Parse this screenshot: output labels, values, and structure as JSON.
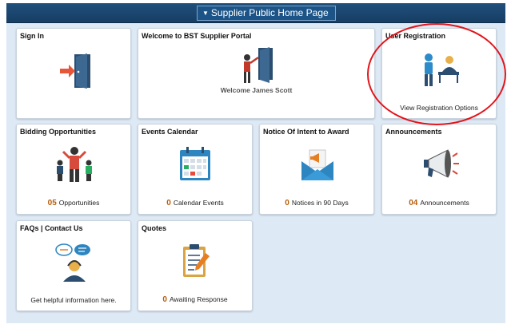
{
  "header": {
    "home_label": "Supplier Public Home Page"
  },
  "tiles": {
    "sign_in": {
      "title": "Sign In"
    },
    "welcome": {
      "title": "Welcome to BST Supplier Portal",
      "name": "Welcome James Scott"
    },
    "registration": {
      "title": "User Registration",
      "footer": "View Registration Options"
    },
    "bidding": {
      "title": "Bidding Opportunities",
      "count": "05",
      "footer": "Opportunities"
    },
    "events": {
      "title": "Events Calendar",
      "count": "0",
      "footer": "Calendar Events"
    },
    "notice": {
      "title": "Notice Of Intent to Award",
      "count": "0",
      "footer": "Notices in 90 Days"
    },
    "announcements": {
      "title": "Announcements",
      "count": "04",
      "footer": "Announcements"
    },
    "faqs": {
      "title": "FAQs | Contact Us",
      "footer": "Get helpful information here."
    },
    "quotes": {
      "title": "Quotes",
      "count": "0",
      "footer": "Awaiting Response"
    }
  },
  "icons": {
    "sign_in": "door-enter-icon",
    "welcome": "presenter-door-icon",
    "registration": "registration-desk-icon",
    "bidding": "bidding-group-icon",
    "events": "calendar-icon",
    "notice": "envelope-megaphone-icon",
    "announcements": "megaphone-icon",
    "faqs": "support-chat-icon",
    "quotes": "clipboard-pencil-icon"
  },
  "colors": {
    "header": "#1f4f7c",
    "background": "#dde9f5",
    "count": "#b75c0a",
    "highlight": "#e2141b"
  }
}
